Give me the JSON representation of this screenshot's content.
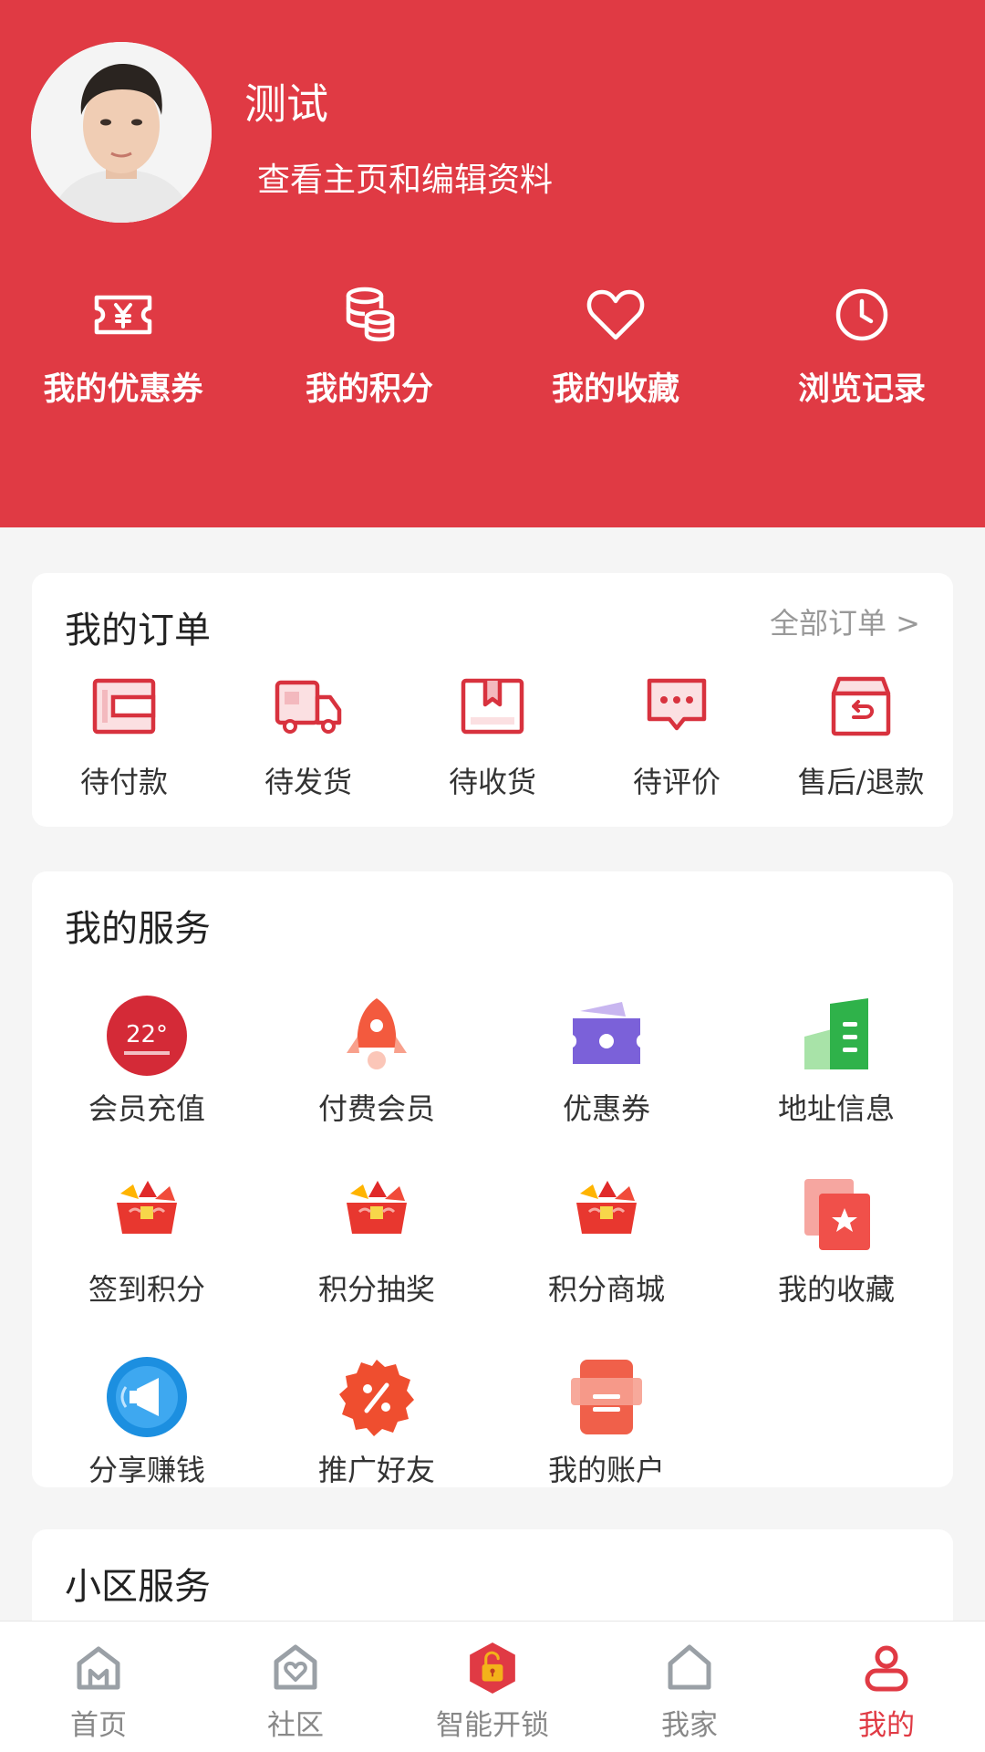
{
  "profile": {
    "username": "测试",
    "profile_link": "查看主页和编辑资料"
  },
  "quick_actions": [
    {
      "label": "我的优惠券",
      "icon": "coupon-yen-icon"
    },
    {
      "label": "我的积分",
      "icon": "coins-stack-icon"
    },
    {
      "label": "我的收藏",
      "icon": "heart-icon"
    },
    {
      "label": "浏览记录",
      "icon": "clock-icon"
    }
  ],
  "orders": {
    "title": "我的订单",
    "all_link": "全部订单 >",
    "items": [
      {
        "label": "待付款",
        "icon": "wallet-icon"
      },
      {
        "label": "待发货",
        "icon": "truck-icon"
      },
      {
        "label": "待收货",
        "icon": "box-icon"
      },
      {
        "label": "待评价",
        "icon": "comment-icon"
      },
      {
        "label": "售后/退款",
        "icon": "return-box-icon"
      }
    ]
  },
  "services": {
    "title": "我的服务",
    "items": [
      {
        "label": "会员充值",
        "icon": "member-badge-icon"
      },
      {
        "label": "付费会员",
        "icon": "rocket-icon"
      },
      {
        "label": "优惠券",
        "icon": "ticket-icon"
      },
      {
        "label": "地址信息",
        "icon": "building-icon"
      },
      {
        "label": "签到积分",
        "icon": "gift-box-icon"
      },
      {
        "label": "积分抽奖",
        "icon": "gift-box-icon"
      },
      {
        "label": "积分商城",
        "icon": "gift-box-icon"
      },
      {
        "label": "我的收藏",
        "icon": "star-card-icon"
      },
      {
        "label": "分享赚钱",
        "icon": "megaphone-icon"
      },
      {
        "label": "推广好友",
        "icon": "percent-badge-icon"
      },
      {
        "label": "我的账户",
        "icon": "account-card-icon"
      }
    ]
  },
  "community": {
    "title": "小区服务"
  },
  "bottom_nav": [
    {
      "label": "首页",
      "icon": "home-icon"
    },
    {
      "label": "社区",
      "icon": "community-icon"
    },
    {
      "label": "智能开锁",
      "icon": "unlock-icon"
    },
    {
      "label": "我家",
      "icon": "house-icon"
    },
    {
      "label": "我的",
      "icon": "user-icon"
    }
  ],
  "colors": {
    "brand_red": "#e03a44",
    "background": "#f5f5f5"
  }
}
